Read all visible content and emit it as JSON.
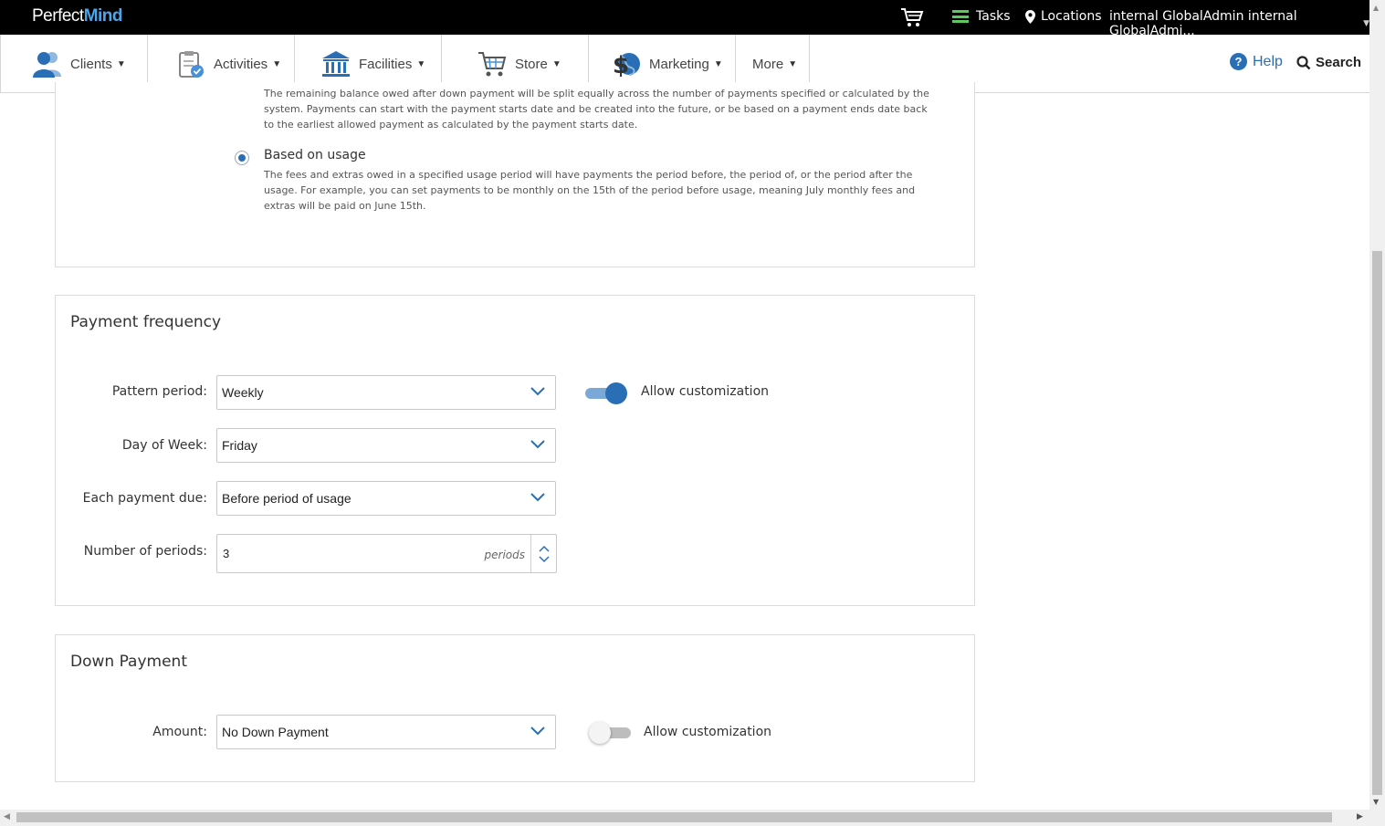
{
  "topbar": {
    "logo_part1": "Perfect",
    "logo_part2": "Mind",
    "tasks_label": "Tasks",
    "locations_label": "Locations",
    "user_label": "internal GlobalAdmin internal GlobalAdmi..."
  },
  "nav": {
    "items": [
      {
        "label": "Clients",
        "icon": "clients-icon"
      },
      {
        "label": "Activities",
        "icon": "activities-icon"
      },
      {
        "label": "Facilities",
        "icon": "facilities-icon"
      },
      {
        "label": "Store",
        "icon": "store-cart-icon"
      },
      {
        "label": "Marketing",
        "icon": "marketing-icon"
      },
      {
        "label": "More",
        "icon": ""
      }
    ],
    "help_label": "Help",
    "search_label": "Search"
  },
  "payment_method": {
    "prev_desc": "The remaining balance owed after down payment will be split equally across the number of payments specified or calculated by the system. Payments can start with the payment starts date and be created into the future, or be based on a payment ends date back to the earliest allowed payment as calculated by the payment starts date.",
    "option_label": "Based on usage",
    "option_desc": "The fees and extras owed in a specified usage period will have payments the period before, the period of, or the period after the usage. For example, you can set payments to be monthly on the 15th of the period before usage, meaning July monthly fees and extras will be paid on June 15th."
  },
  "payment_frequency": {
    "title": "Payment frequency",
    "pattern_label": "Pattern period:",
    "pattern_value": "Weekly",
    "allow_label": "Allow customization",
    "day_label": "Day of Week:",
    "day_value": "Friday",
    "due_label": "Each payment due:",
    "due_value": "Before period of usage",
    "periods_label": "Number of periods:",
    "periods_value": "3",
    "periods_unit": "periods"
  },
  "down_payment": {
    "title": "Down Payment",
    "amount_label": "Amount:",
    "amount_value": "No Down Payment",
    "allow_label": "Allow customization"
  },
  "colors": {
    "brand_blue": "#2a6fb6",
    "toggle_on_track": "#7aa8d8",
    "tasks_green": "#5dc85d"
  }
}
